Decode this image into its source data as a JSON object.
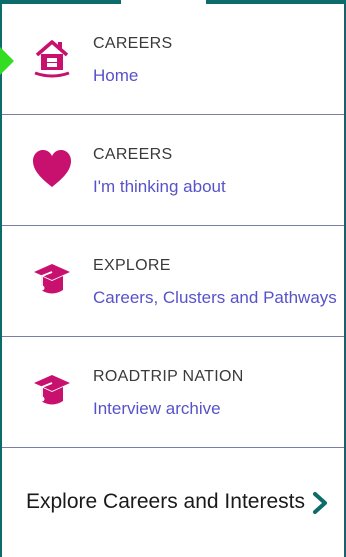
{
  "menu": {
    "items": [
      {
        "category": "CAREERS",
        "link": "Home",
        "icon": "house-icon"
      },
      {
        "category": "CAREERS",
        "link": "I'm thinking about",
        "icon": "heart-icon"
      },
      {
        "category": "EXPLORE",
        "link": "Careers, Clusters and Pathways",
        "icon": "graduation-cap-icon"
      },
      {
        "category": "ROADTRIP NATION",
        "link": "Interview archive",
        "icon": "graduation-cap-icon"
      }
    ]
  },
  "footer": {
    "label": "Explore Careers and Interests",
    "icon": "chevron-right-icon"
  },
  "colors": {
    "accent_pink": "#c8106e",
    "link_purple": "#5752c9",
    "teal": "#0d6b6b",
    "pointer_green": "#33dd22"
  }
}
